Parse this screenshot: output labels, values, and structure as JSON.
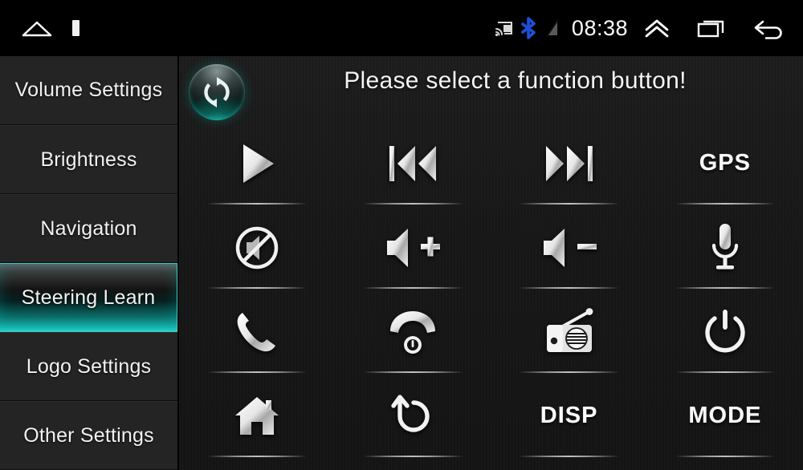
{
  "statusbar": {
    "left_icons": [
      {
        "name": "home-icon",
        "label": "home"
      },
      {
        "name": "stop-indicator-icon",
        "label": "stop"
      }
    ],
    "right_icons_before_clock": [
      {
        "name": "cast-screen-icon",
        "label": "cast"
      },
      {
        "name": "bluetooth-icon",
        "label": "bluetooth",
        "color": "#1f4fd8"
      },
      {
        "name": "signal-off-icon",
        "label": "no signal"
      }
    ],
    "clock": "08:38",
    "right_icons_after_clock": [
      {
        "name": "chevron-double-up-icon",
        "label": "expand"
      },
      {
        "name": "recent-apps-icon",
        "label": "recents"
      },
      {
        "name": "back-arrow-icon",
        "label": "back"
      }
    ]
  },
  "sidebar": {
    "items": [
      {
        "label": "Volume Settings",
        "selected": false
      },
      {
        "label": "Brightness",
        "selected": false
      },
      {
        "label": "Navigation",
        "selected": false
      },
      {
        "label": "Steering Learn",
        "selected": true
      },
      {
        "label": "Logo Settings",
        "selected": false
      },
      {
        "label": "Other Settings",
        "selected": false
      }
    ],
    "selected_index": 3,
    "highlight_color": "#2fd6cc"
  },
  "main": {
    "title": "Please select a function button!",
    "refresh_button": {
      "name": "refresh-reset-button",
      "label": "Reset"
    },
    "buttons": [
      {
        "id": "play",
        "icon": "play-icon",
        "label": "",
        "type": "icon"
      },
      {
        "id": "prev",
        "icon": "previous-track-icon",
        "label": "",
        "type": "icon"
      },
      {
        "id": "next",
        "icon": "next-track-icon",
        "label": "",
        "type": "icon"
      },
      {
        "id": "gps",
        "icon": "gps-text-icon",
        "label": "GPS",
        "type": "text"
      },
      {
        "id": "mute",
        "icon": "mute-icon",
        "label": "",
        "type": "icon"
      },
      {
        "id": "vol_up",
        "icon": "volume-up-icon",
        "label": "",
        "type": "icon"
      },
      {
        "id": "vol_down",
        "icon": "volume-down-icon",
        "label": "",
        "type": "icon"
      },
      {
        "id": "voice",
        "icon": "microphone-icon",
        "label": "",
        "type": "icon"
      },
      {
        "id": "call_answer",
        "icon": "phone-answer-icon",
        "label": "",
        "type": "icon"
      },
      {
        "id": "call_end",
        "icon": "phone-hangup-icon",
        "label": "",
        "type": "icon"
      },
      {
        "id": "radio",
        "icon": "radio-icon",
        "label": "",
        "type": "icon"
      },
      {
        "id": "power",
        "icon": "power-icon",
        "label": "",
        "type": "icon"
      },
      {
        "id": "home",
        "icon": "home-icon",
        "label": "",
        "type": "icon"
      },
      {
        "id": "back",
        "icon": "return-back-icon",
        "label": "",
        "type": "icon"
      },
      {
        "id": "disp",
        "icon": "disp-text-icon",
        "label": "DISP",
        "type": "text"
      },
      {
        "id": "mode",
        "icon": "mode-text-icon",
        "label": "MODE",
        "type": "text"
      }
    ]
  }
}
